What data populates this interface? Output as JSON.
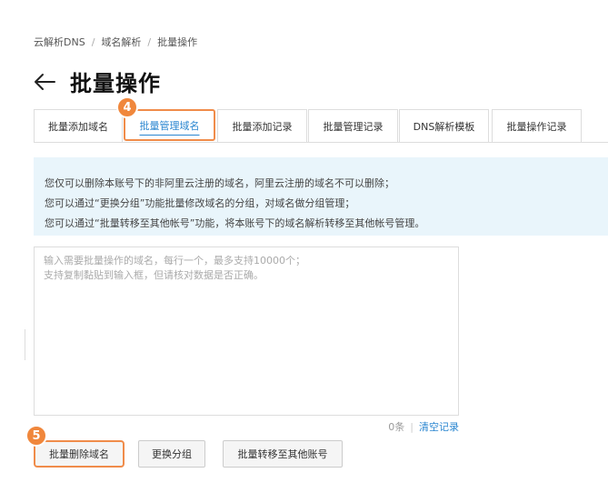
{
  "breadcrumb": [
    "云解析DNS",
    "域名解析",
    "批量操作"
  ],
  "breadcrumb_separator": "/",
  "page_title": "批量操作",
  "tabs": [
    {
      "label": "批量添加域名"
    },
    {
      "label": "批量管理域名"
    },
    {
      "label": "批量添加记录"
    },
    {
      "label": "批量管理记录"
    },
    {
      "label": "DNS解析模板"
    },
    {
      "label": "批量操作记录"
    }
  ],
  "active_tab": "批量管理域名",
  "step_badges": {
    "tab_step": "4",
    "button_step": "5"
  },
  "notice": {
    "line1": "您仅可以删除本账号下的非阿里云注册的域名，阿里云注册的域名不可以删除；",
    "line2": "您可以通过“更换分组”功能批量修改域名的分组，对域名做分组管理；",
    "line3": "您可以通过“批量转移至其他帐号”功能，将本账号下的域名解析转移至其他帐号管理。"
  },
  "domain_input": {
    "value": "",
    "placeholder": "输入需要批量操作的域名，每行一个，最多支持10000个；\n支持复制黏贴到输入框，但请核对数据是否正确。"
  },
  "counter": {
    "count_text": "0条",
    "divider": "|",
    "clear_label": "清空记录"
  },
  "actions": {
    "delete_label": "批量删除域名",
    "change_group_label": "更换分组",
    "transfer_label": "批量转移至其他账号"
  },
  "colors": {
    "accent": "#2a86d0",
    "highlight": "#f08c4a",
    "notice_bg": "#e9f5fb"
  }
}
